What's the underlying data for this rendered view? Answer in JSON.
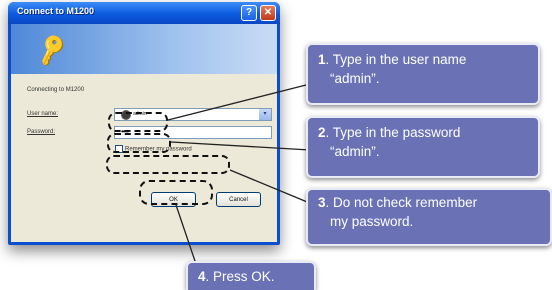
{
  "dialog": {
    "title": "Connect to M1200",
    "help_glyph": "?",
    "close_glyph": "✕",
    "connecting_text": "Connecting to M1200",
    "user_label": "User name:",
    "password_label": "Password:",
    "user_value": "admin",
    "password_value": "••••",
    "remember_label": "Remember my password",
    "remember_checked": false,
    "ok_label": "OK",
    "cancel_label": "Cancel",
    "dropdown_glyph": "▾",
    "keys_glyph": "🔑"
  },
  "callouts": [
    {
      "number": "1",
      "text_line1": ". Type in the user name",
      "text_line2": "“admin”."
    },
    {
      "number": "2",
      "text_line1": ". Type in the password",
      "text_line2": "“admin”."
    },
    {
      "number": "3",
      "text_line1": ". Do not check remember",
      "text_line2": "my password."
    },
    {
      "number": "4",
      "text_line1": ". Press OK."
    }
  ],
  "colors": {
    "callout_bg": "#6a72b5",
    "titlebar": "#0b5ae0",
    "dialog_bg": "#ece9d8"
  }
}
